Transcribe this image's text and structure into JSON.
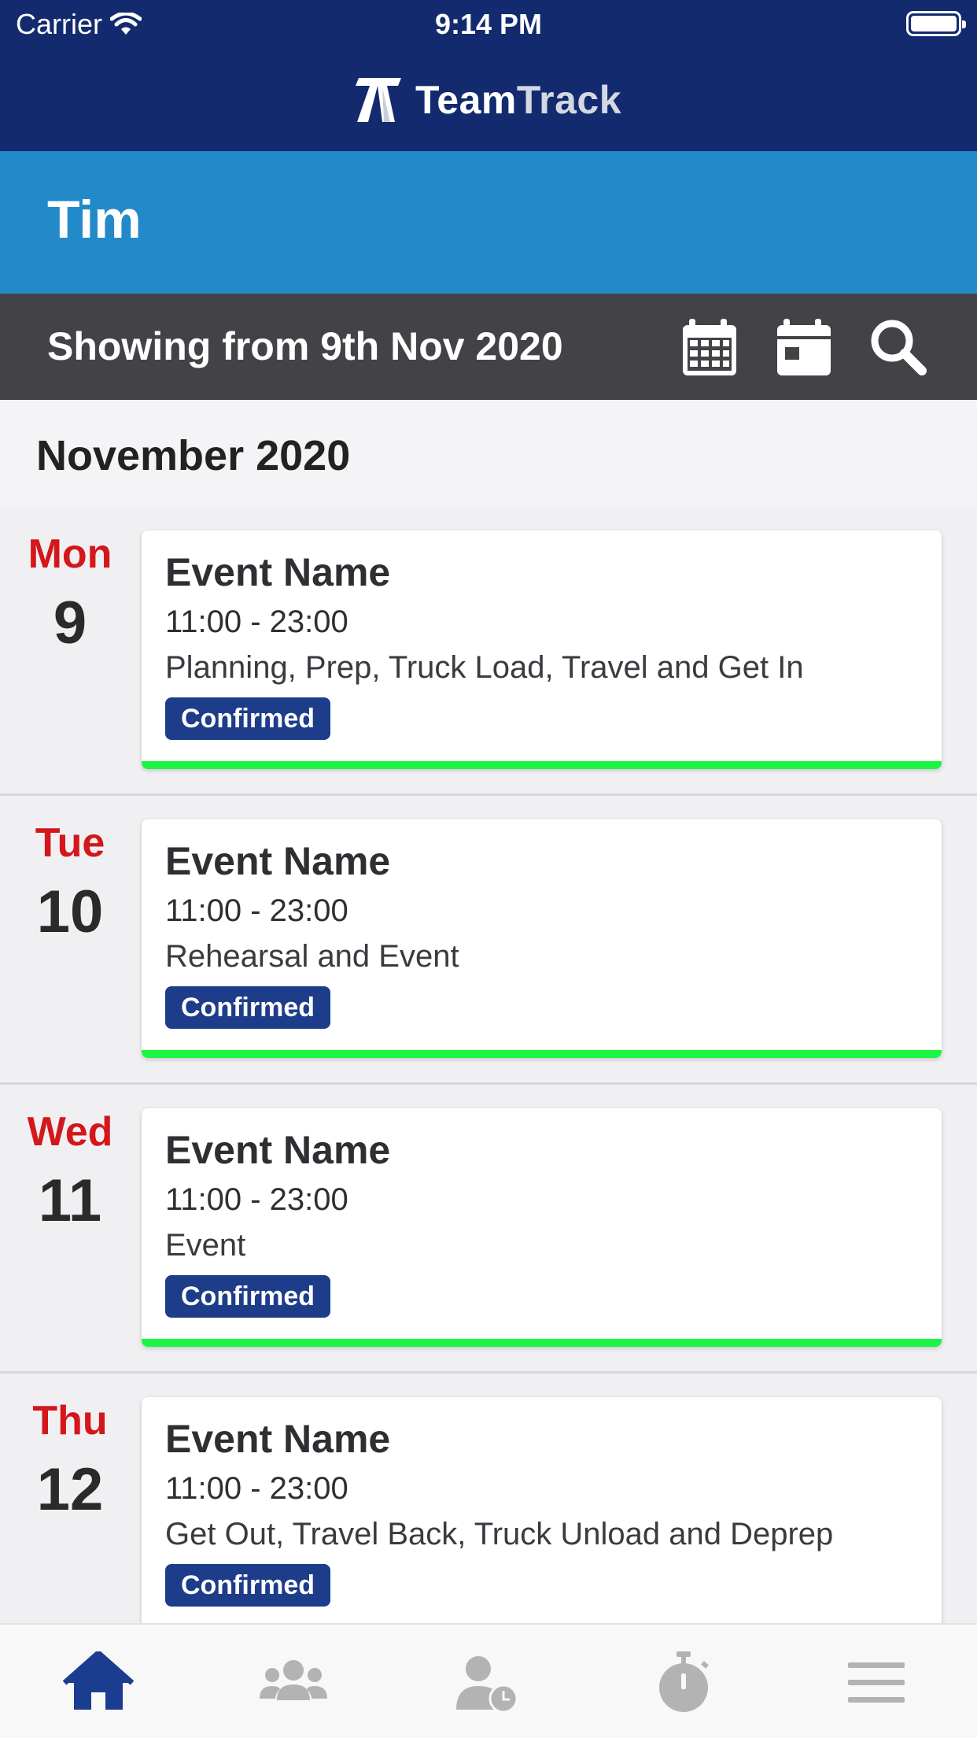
{
  "status_bar": {
    "carrier": "Carrier",
    "time": "9:14 PM"
  },
  "brand": {
    "name_part1": "Team",
    "name_part2": "Track"
  },
  "user": {
    "name": "Tim"
  },
  "filter": {
    "showing_text": "Showing from 9th Nov 2020"
  },
  "month_header": "November 2020",
  "events": [
    {
      "dow": "Mon",
      "day": "9",
      "title": "Event Name",
      "time": "11:00 - 23:00",
      "description": "Planning, Prep, Truck Load, Travel and Get In",
      "status": "Confirmed"
    },
    {
      "dow": "Tue",
      "day": "10",
      "title": "Event Name",
      "time": "11:00 - 23:00",
      "description": "Rehearsal and Event",
      "status": "Confirmed"
    },
    {
      "dow": "Wed",
      "day": "11",
      "title": "Event Name",
      "time": "11:00 - 23:00",
      "description": "Event",
      "status": "Confirmed"
    },
    {
      "dow": "Thu",
      "day": "12",
      "title": "Event Name",
      "time": "11:00 - 23:00",
      "description": "Get Out, Travel Back, Truck Unload and Deprep",
      "status": "Confirmed"
    }
  ],
  "icons": {
    "month_view": "calendar-grid-icon",
    "day_view": "calendar-day-icon",
    "search": "search-icon",
    "tabs": [
      "home-icon",
      "team-icon",
      "user-clock-icon",
      "stopwatch-icon",
      "menu-icon"
    ]
  },
  "colors": {
    "header": "#132b6e",
    "user_bar": "#238aca",
    "filter_bar": "#434347",
    "day_of_week": "#d3171a",
    "badge": "#1d3c8a",
    "status_line": "#1cf543",
    "active_tab": "#1b3d8f",
    "inactive_tab": "#b3b3b3"
  }
}
